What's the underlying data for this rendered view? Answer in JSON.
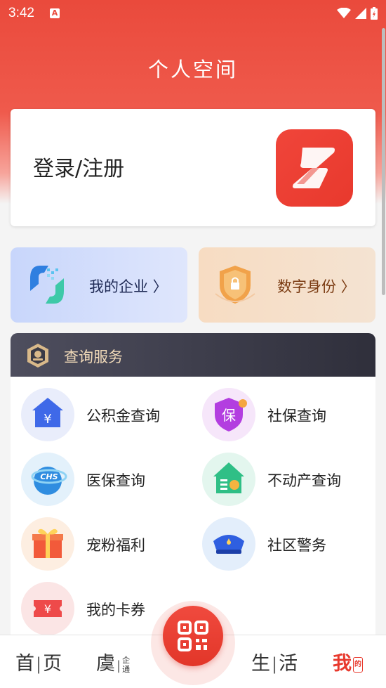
{
  "status_bar": {
    "time": "3:42",
    "notification_glyph": "A"
  },
  "header": {
    "title": "个人空间"
  },
  "login_card": {
    "label": "登录/注册",
    "logo_icon": "app-logo-icon"
  },
  "quick_actions": [
    {
      "label": "我的企业 〉",
      "icon": "enterprise-icon"
    },
    {
      "label": "数字身份 〉",
      "icon": "shield-lock-icon"
    }
  ],
  "services": {
    "title": "查询服务",
    "items": [
      {
        "label": "公积金查询",
        "icon": "house-yuan-icon"
      },
      {
        "label": "社保查询",
        "icon": "social-security-icon"
      },
      {
        "label": "医保查询",
        "icon": "medical-insurance-icon"
      },
      {
        "label": "不动产查询",
        "icon": "real-estate-icon"
      },
      {
        "label": "宠粉福利",
        "icon": "gift-icon"
      },
      {
        "label": "社区警务",
        "icon": "police-cap-icon"
      },
      {
        "label": "我的卡券",
        "icon": "coupon-icon"
      }
    ]
  },
  "bottom_nav": {
    "home": {
      "left": "首",
      "right": "页"
    },
    "yu": {
      "main": "虞",
      "sub_top": "企",
      "sub_bottom": "通"
    },
    "life": {
      "left": "生",
      "right": "活"
    },
    "me": {
      "main": "我",
      "badge": "的"
    }
  },
  "colors": {
    "brand_red": "#E8392D",
    "accent_gold": "#F0D9B8"
  }
}
